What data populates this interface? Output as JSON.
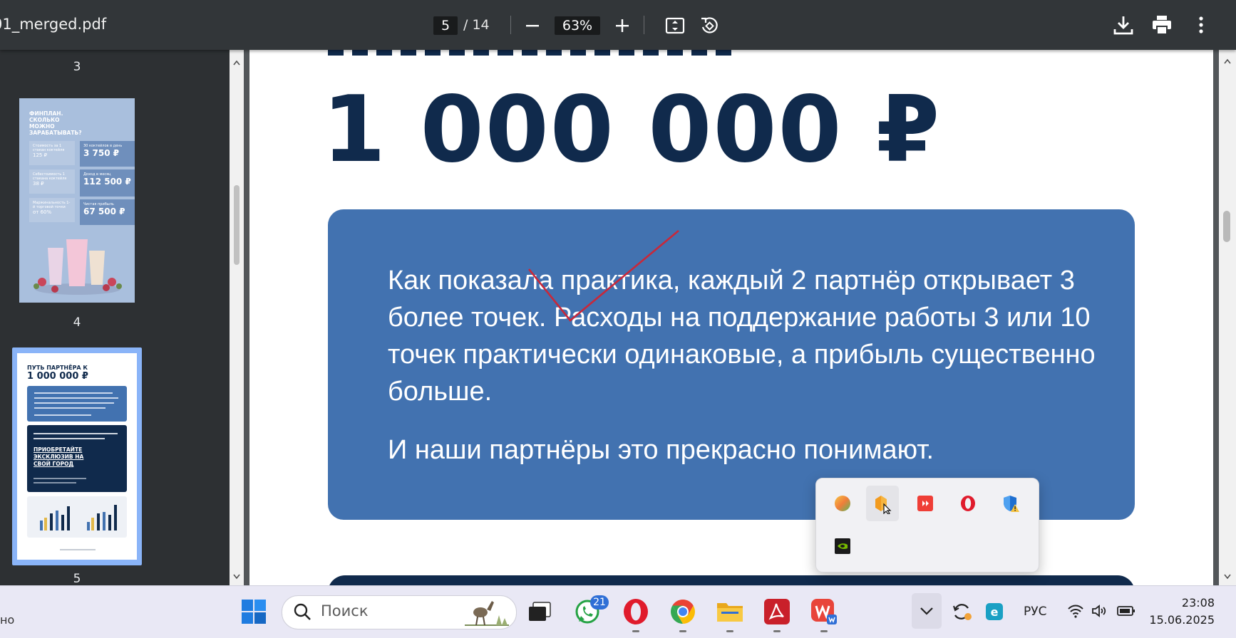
{
  "toolbar": {
    "filename": "01_merged.pdf",
    "current_page": "5",
    "total_pages": "/ 14",
    "zoom": "63%",
    "zoom_out_icon": "minus-icon",
    "zoom_in_icon": "plus-icon",
    "fit_icon": "fit-page-icon",
    "rotate_icon": "rotate-icon",
    "download_icon": "download-icon",
    "print_icon": "print-icon",
    "more_icon": "more-vertical-icon"
  },
  "sidebar": {
    "labels": [
      "3",
      "4",
      "5"
    ],
    "thumb4": {
      "title": "ФИНПЛАН. СКОЛЬКО МОЖНО ЗАРАБАТЫВАТЬ?",
      "cells": [
        {
          "label": "Стоимость за 1 стакан коктейля",
          "value": "125 ₽"
        },
        {
          "label": "30 коктейлов в день",
          "value": "3 750 ₽"
        },
        {
          "label": "Себестоимость 1 стакана коктейля",
          "value": "38 ₽"
        },
        {
          "label": "Доход в месяц",
          "value": "112 500 ₽"
        },
        {
          "label": "Маржинальность 1-й торговой точки",
          "value": "от 60%"
        },
        {
          "label": "Чистая прибыль",
          "value": "67 500 ₽"
        }
      ]
    },
    "thumb5": {
      "title": "ПУТЬ ПАРТНЁРА К",
      "amount": "1 000 000 ₽",
      "cta": "ПРИОБРЕТАЙТЕ ЭКСКЛЮЗИВ НА СВОЙ ГОРОД"
    }
  },
  "document": {
    "big_amount": "1 000 000 ₽",
    "paragraph1": "Как показала практика, каждый 2 партнёр открывает 3  более точек.  Расходы на поддержание работы 3 или 10 точек практически одинаковые, а прибыль существенно больше.",
    "paragraph2": "И наши партнёры это прекрасно понимают."
  },
  "tray_popup": {
    "icons": [
      "color-circle-icon",
      "audio-app-icon",
      "anydesk-icon",
      "opera-icon",
      "defender-warning-icon",
      "nvidia-icon"
    ]
  },
  "taskbar": {
    "left_text": "но",
    "search_placeholder": "Поиск",
    "whatsapp_badge": "21",
    "language": "РУС",
    "time": "23:08",
    "date": "15.06.2025"
  },
  "colors": {
    "toolbar_bg": "#323639",
    "sidebar_bg": "#2d3033",
    "title_navy": "#102a4c",
    "box_blue": "#4272b0",
    "taskbar_bg": "#e9e8f5"
  }
}
